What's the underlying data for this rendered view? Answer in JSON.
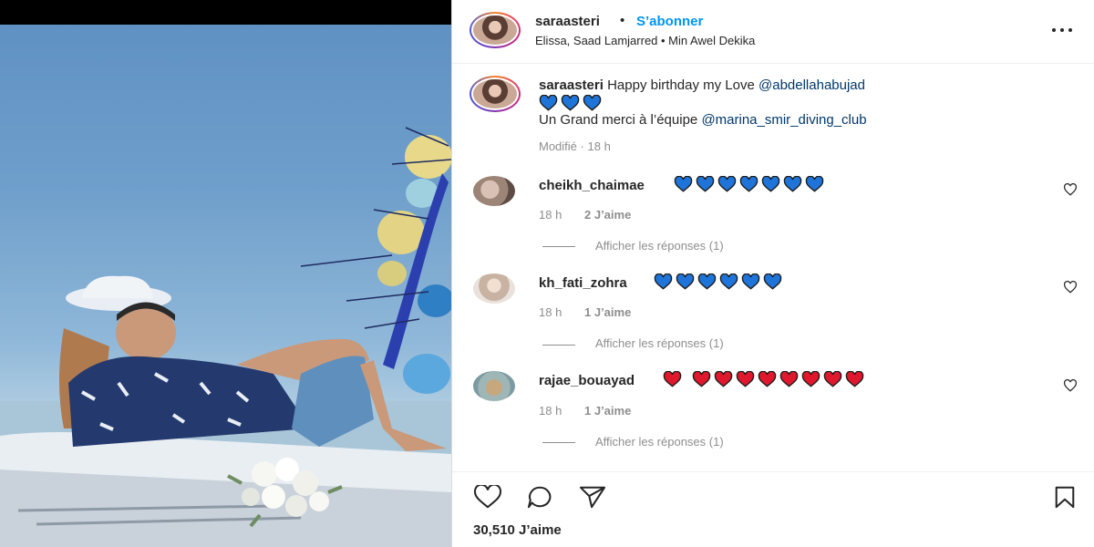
{
  "post_header": {
    "username": "saraasteri",
    "separator": "•",
    "follow_label": "S’abonner",
    "audio": "Elissa, Saad Lamjarred • Min Awel Dekika",
    "more_icon": "more-horizontal-icon"
  },
  "caption": {
    "username": "saraasteri",
    "text_before": "Happy birthday my Love",
    "mention_1": "@abdellahabujad",
    "line2_text": "Un Grand merci à l’équipe",
    "mention_2": "@marina_smir_diving_club",
    "edited_label": "Modifié",
    "separator": "·",
    "time": "18 h",
    "hearts": {
      "count": 3,
      "color": "#1e74d8"
    }
  },
  "comments": [
    {
      "username": "cheikh_chaimae",
      "hearts": {
        "count": 7,
        "color": "#1e74d8"
      },
      "time": "18 h",
      "likes": "2 J’aime",
      "replies": "Afficher les réponses (1)"
    },
    {
      "username": "kh_fati_zohra",
      "hearts": {
        "count": 6,
        "color": "#1e74d8"
      },
      "time": "18 h",
      "likes": "1 J’aime",
      "replies": "Afficher les réponses (1)"
    },
    {
      "username": "rajae_bouayad",
      "hearts": {
        "count": 9,
        "color": "#e0182d",
        "gap_after_first": true
      },
      "time": "18 h",
      "likes": "1 J’aime",
      "replies": "Afficher les réponses (1)"
    }
  ],
  "actions": {
    "like_icon": "heart-outline-icon",
    "comment_icon": "comment-icon",
    "share_icon": "paper-plane-icon",
    "save_icon": "bookmark-icon"
  },
  "likes_count": "30,510 J’aime",
  "colors": {
    "accent": "#0095f6",
    "mention": "#00376b",
    "muted": "#8e8e8e",
    "text": "#262626"
  }
}
